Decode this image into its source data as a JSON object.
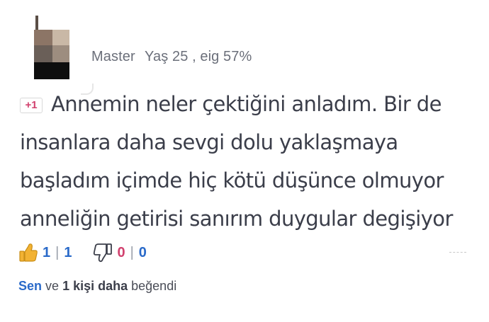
{
  "author": {
    "username": "Master",
    "stats": "Yaş 25 , eig 57%"
  },
  "post": {
    "badge": "+1",
    "lines": [
      "Annemin neler çektiğini anladım. Bir de",
      "insanlara daha sevgi dolu yaklaşmaya",
      "başladım içimde hiç kötü düşünce olmuyor",
      "anneliğin getirisi sanırım duygular degişiyor"
    ]
  },
  "reactions": {
    "like": {
      "icon": "thumbs-up-icon",
      "count": "1",
      "separator": "|",
      "total": "1"
    },
    "dislike": {
      "icon": "thumbs-down-icon",
      "count": "0",
      "separator": "|",
      "total": "0"
    }
  },
  "liked_by": {
    "you": "Sen",
    "connector": "ve",
    "others": "1 kişi daha",
    "suffix": "beğendi"
  },
  "colors": {
    "accent_blue": "#2a6ac9",
    "accent_pink": "#d1416e",
    "like_icon_yellow": "#f2b233",
    "text": "#3b3e4a",
    "muted": "#6b6f7a"
  }
}
